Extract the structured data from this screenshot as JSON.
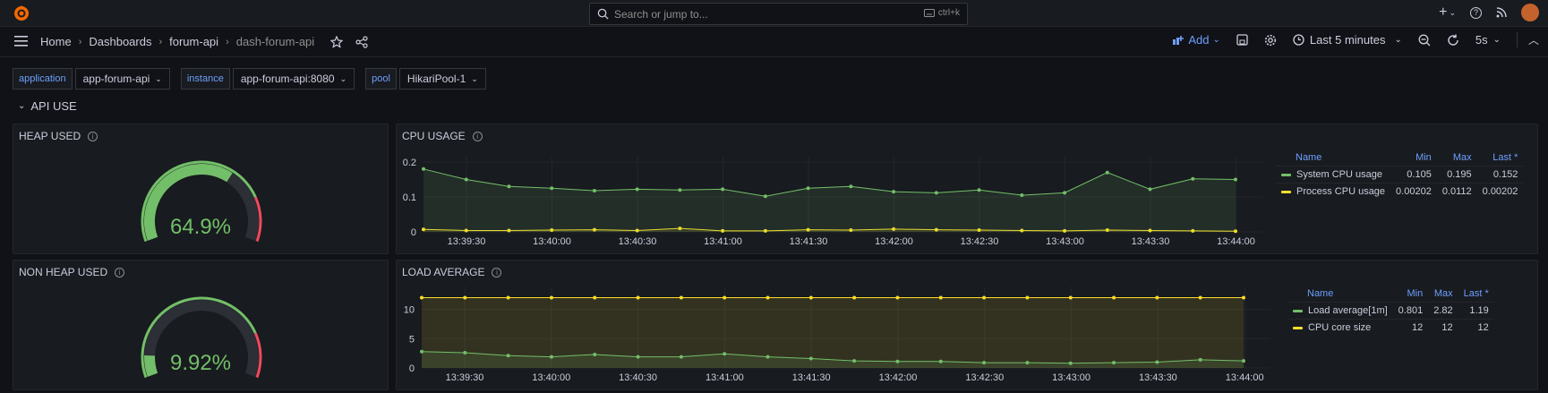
{
  "topbar": {
    "search_placeholder": "Search or jump to...",
    "search_shortcut": "ctrl+k",
    "add_menu": "+"
  },
  "breadcrumb": [
    "Home",
    "Dashboards",
    "forum-api",
    "dash-forum-api"
  ],
  "toolbar": {
    "add_label": "Add",
    "time_range": "Last 5 minutes",
    "refresh_interval": "5s"
  },
  "variables": [
    {
      "label": "application",
      "value": "app-forum-api"
    },
    {
      "label": "instance",
      "value": "app-forum-api:8080"
    },
    {
      "label": "pool",
      "value": "HikariPool-1"
    }
  ],
  "row_title": "API USE",
  "panels": {
    "heap": {
      "title": "HEAP USED",
      "value": "64.9%",
      "fraction": 0.649
    },
    "nonheap": {
      "title": "NON HEAP USED",
      "value": "9.92%",
      "fraction": 0.0992
    },
    "cpu": {
      "title": "CPU USAGE",
      "legend_headers": [
        "Name",
        "Min",
        "Max",
        "Last *"
      ],
      "legend": [
        {
          "name": "System CPU usage",
          "min": "0.105",
          "max": "0.195",
          "last": "0.152",
          "color": "#73bf69"
        },
        {
          "name": "Process CPU usage",
          "min": "0.00202",
          "max": "0.0112",
          "last": "0.00202",
          "color": "#fade2a"
        }
      ]
    },
    "load": {
      "title": "LOAD AVERAGE",
      "legend_headers": [
        "Name",
        "Min",
        "Max",
        "Last *"
      ],
      "legend": [
        {
          "name": "Load average[1m]",
          "min": "0.801",
          "max": "2.82",
          "last": "1.19",
          "color": "#73bf69"
        },
        {
          "name": "CPU core size",
          "min": "12",
          "max": "12",
          "last": "12",
          "color": "#fade2a"
        }
      ]
    }
  },
  "chart_data": [
    {
      "type": "line",
      "title": "CPU USAGE",
      "x_ticks": [
        "13:39:30",
        "13:40:00",
        "13:40:30",
        "13:41:00",
        "13:41:30",
        "13:42:00",
        "13:42:30",
        "13:43:00",
        "13:43:30",
        "13:44:00"
      ],
      "y_ticks": [
        "0",
        "0.1",
        "0.2"
      ],
      "ylim": [
        0,
        0.2
      ],
      "series": [
        {
          "name": "System CPU usage",
          "color": "#73bf69",
          "values": [
            0.18,
            0.15,
            0.13,
            0.125,
            0.118,
            0.122,
            0.12,
            0.122,
            0.102,
            0.125,
            0.13,
            0.115,
            0.112,
            0.12,
            0.105,
            0.112,
            0.17,
            0.122,
            0.152,
            0.15
          ]
        },
        {
          "name": "Process CPU usage",
          "color": "#fade2a",
          "values": [
            0.007,
            0.004,
            0.004,
            0.005,
            0.006,
            0.004,
            0.01,
            0.003,
            0.003,
            0.006,
            0.005,
            0.008,
            0.006,
            0.005,
            0.004,
            0.003,
            0.005,
            0.004,
            0.003,
            0.002
          ]
        }
      ]
    },
    {
      "type": "line",
      "title": "LOAD AVERAGE",
      "x_ticks": [
        "13:39:30",
        "13:40:00",
        "13:40:30",
        "13:41:00",
        "13:41:30",
        "13:42:00",
        "13:42:30",
        "13:43:00",
        "13:43:30",
        "13:44:00"
      ],
      "y_ticks": [
        "0",
        "5",
        "10"
      ],
      "ylim": [
        0,
        13
      ],
      "series": [
        {
          "name": "Load average[1m]",
          "color": "#73bf69",
          "values": [
            2.8,
            2.6,
            2.1,
            1.9,
            2.3,
            1.9,
            1.9,
            2.4,
            1.9,
            1.6,
            1.2,
            1.1,
            1.1,
            0.9,
            0.9,
            0.8,
            0.9,
            1.0,
            1.4,
            1.2
          ]
        },
        {
          "name": "CPU core size",
          "color": "#fade2a",
          "values": [
            12,
            12,
            12,
            12,
            12,
            12,
            12,
            12,
            12,
            12,
            12,
            12,
            12,
            12,
            12,
            12,
            12,
            12,
            12,
            12
          ]
        }
      ]
    }
  ]
}
